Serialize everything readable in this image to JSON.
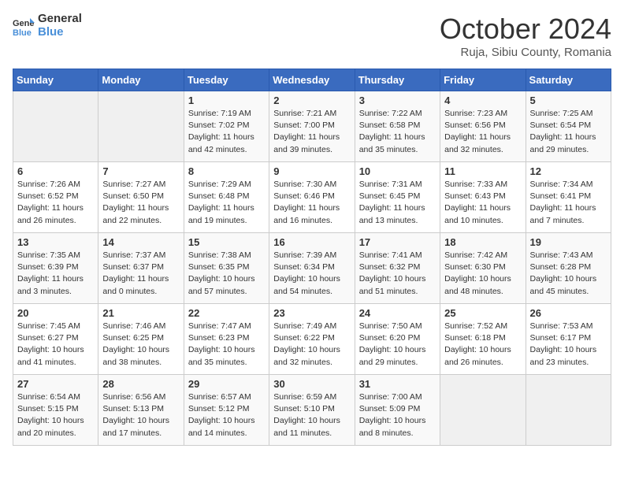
{
  "header": {
    "logo": {
      "text1": "General",
      "text2": "Blue"
    },
    "title": "October 2024",
    "location": "Ruja, Sibiu County, Romania"
  },
  "days_of_week": [
    "Sunday",
    "Monday",
    "Tuesday",
    "Wednesday",
    "Thursday",
    "Friday",
    "Saturday"
  ],
  "weeks": [
    [
      null,
      null,
      {
        "day": 1,
        "sunrise": "7:19 AM",
        "sunset": "7:02 PM",
        "daylight": "11 hours and 42 minutes."
      },
      {
        "day": 2,
        "sunrise": "7:21 AM",
        "sunset": "7:00 PM",
        "daylight": "11 hours and 39 minutes."
      },
      {
        "day": 3,
        "sunrise": "7:22 AM",
        "sunset": "6:58 PM",
        "daylight": "11 hours and 35 minutes."
      },
      {
        "day": 4,
        "sunrise": "7:23 AM",
        "sunset": "6:56 PM",
        "daylight": "11 hours and 32 minutes."
      },
      {
        "day": 5,
        "sunrise": "7:25 AM",
        "sunset": "6:54 PM",
        "daylight": "11 hours and 29 minutes."
      }
    ],
    [
      {
        "day": 6,
        "sunrise": "7:26 AM",
        "sunset": "6:52 PM",
        "daylight": "11 hours and 26 minutes."
      },
      {
        "day": 7,
        "sunrise": "7:27 AM",
        "sunset": "6:50 PM",
        "daylight": "11 hours and 22 minutes."
      },
      {
        "day": 8,
        "sunrise": "7:29 AM",
        "sunset": "6:48 PM",
        "daylight": "11 hours and 19 minutes."
      },
      {
        "day": 9,
        "sunrise": "7:30 AM",
        "sunset": "6:46 PM",
        "daylight": "11 hours and 16 minutes."
      },
      {
        "day": 10,
        "sunrise": "7:31 AM",
        "sunset": "6:45 PM",
        "daylight": "11 hours and 13 minutes."
      },
      {
        "day": 11,
        "sunrise": "7:33 AM",
        "sunset": "6:43 PM",
        "daylight": "11 hours and 10 minutes."
      },
      {
        "day": 12,
        "sunrise": "7:34 AM",
        "sunset": "6:41 PM",
        "daylight": "11 hours and 7 minutes."
      }
    ],
    [
      {
        "day": 13,
        "sunrise": "7:35 AM",
        "sunset": "6:39 PM",
        "daylight": "11 hours and 3 minutes."
      },
      {
        "day": 14,
        "sunrise": "7:37 AM",
        "sunset": "6:37 PM",
        "daylight": "11 hours and 0 minutes."
      },
      {
        "day": 15,
        "sunrise": "7:38 AM",
        "sunset": "6:35 PM",
        "daylight": "10 hours and 57 minutes."
      },
      {
        "day": 16,
        "sunrise": "7:39 AM",
        "sunset": "6:34 PM",
        "daylight": "10 hours and 54 minutes."
      },
      {
        "day": 17,
        "sunrise": "7:41 AM",
        "sunset": "6:32 PM",
        "daylight": "10 hours and 51 minutes."
      },
      {
        "day": 18,
        "sunrise": "7:42 AM",
        "sunset": "6:30 PM",
        "daylight": "10 hours and 48 minutes."
      },
      {
        "day": 19,
        "sunrise": "7:43 AM",
        "sunset": "6:28 PM",
        "daylight": "10 hours and 45 minutes."
      }
    ],
    [
      {
        "day": 20,
        "sunrise": "7:45 AM",
        "sunset": "6:27 PM",
        "daylight": "10 hours and 41 minutes."
      },
      {
        "day": 21,
        "sunrise": "7:46 AM",
        "sunset": "6:25 PM",
        "daylight": "10 hours and 38 minutes."
      },
      {
        "day": 22,
        "sunrise": "7:47 AM",
        "sunset": "6:23 PM",
        "daylight": "10 hours and 35 minutes."
      },
      {
        "day": 23,
        "sunrise": "7:49 AM",
        "sunset": "6:22 PM",
        "daylight": "10 hours and 32 minutes."
      },
      {
        "day": 24,
        "sunrise": "7:50 AM",
        "sunset": "6:20 PM",
        "daylight": "10 hours and 29 minutes."
      },
      {
        "day": 25,
        "sunrise": "7:52 AM",
        "sunset": "6:18 PM",
        "daylight": "10 hours and 26 minutes."
      },
      {
        "day": 26,
        "sunrise": "7:53 AM",
        "sunset": "6:17 PM",
        "daylight": "10 hours and 23 minutes."
      }
    ],
    [
      {
        "day": 27,
        "sunrise": "6:54 AM",
        "sunset": "5:15 PM",
        "daylight": "10 hours and 20 minutes."
      },
      {
        "day": 28,
        "sunrise": "6:56 AM",
        "sunset": "5:13 PM",
        "daylight": "10 hours and 17 minutes."
      },
      {
        "day": 29,
        "sunrise": "6:57 AM",
        "sunset": "5:12 PM",
        "daylight": "10 hours and 14 minutes."
      },
      {
        "day": 30,
        "sunrise": "6:59 AM",
        "sunset": "5:10 PM",
        "daylight": "10 hours and 11 minutes."
      },
      {
        "day": 31,
        "sunrise": "7:00 AM",
        "sunset": "5:09 PM",
        "daylight": "10 hours and 8 minutes."
      },
      null,
      null
    ]
  ]
}
